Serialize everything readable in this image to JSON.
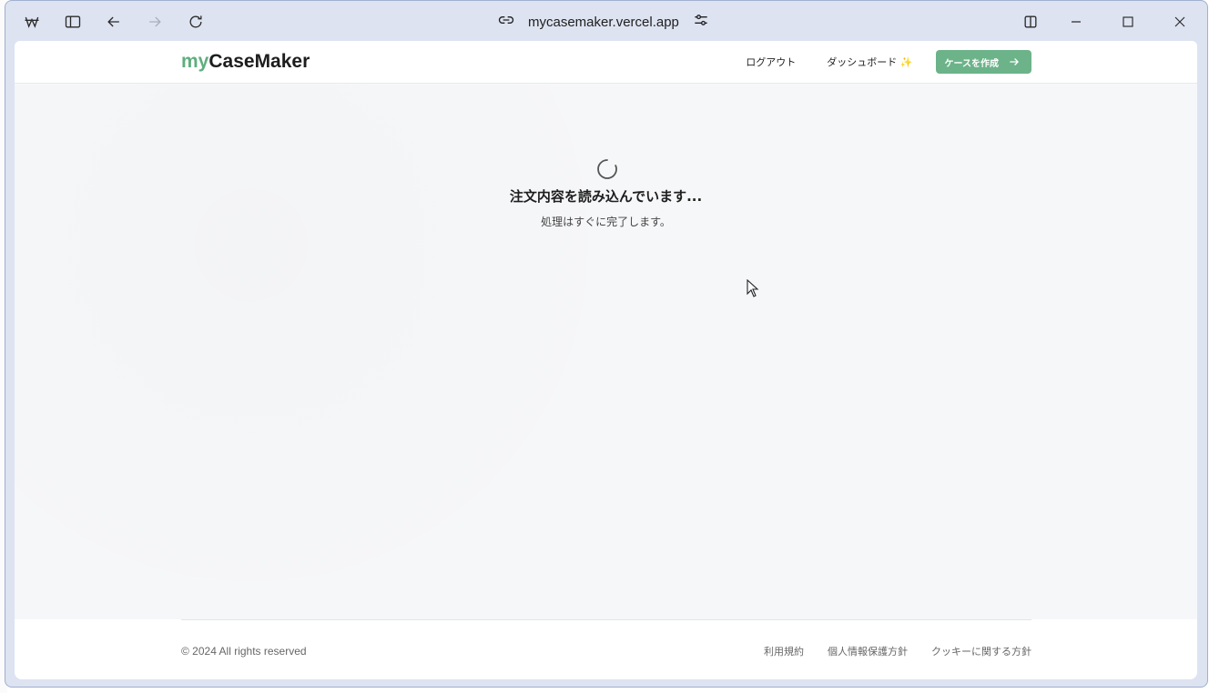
{
  "browser": {
    "url": "mycasemaker.vercel.app",
    "icons": {
      "app": "app-logo-icon",
      "sidebar": "sidebar-toggle-icon",
      "back": "back-arrow-icon",
      "forward": "forward-arrow-icon",
      "reload": "reload-icon",
      "link": "link-icon",
      "settings": "tune-icon",
      "split": "split-view-icon",
      "minimize": "minimize-icon",
      "maximize": "maximize-icon",
      "close": "close-icon"
    }
  },
  "site": {
    "logo_prefix": "my",
    "logo_main": "CaseMaker",
    "nav": {
      "logout": "ログアウト",
      "dashboard": "ダッシュボード ✨",
      "create_case": "ケースを作成"
    }
  },
  "loading": {
    "title": "注文内容を読み込んでいます...",
    "subtitle": "処理はすぐに完了します。"
  },
  "footer": {
    "copyright": "© 2024 All rights reserved",
    "links": [
      "利用規約",
      "個人情報保護方針",
      "クッキーに関する方針"
    ]
  },
  "colors": {
    "accent": "#6cb38a",
    "logo_accent": "#5fae7e"
  }
}
